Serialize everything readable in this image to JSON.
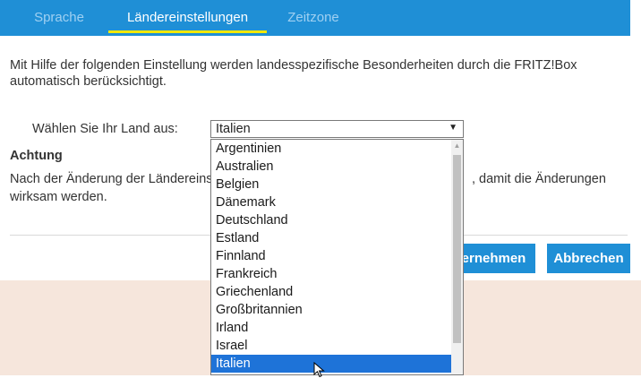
{
  "tabs": [
    {
      "label": "Sprache",
      "active": false
    },
    {
      "label": "Ländereinstellungen",
      "active": true
    },
    {
      "label": "Zeitzone",
      "active": false
    }
  ],
  "description": "Mit Hilfe der folgenden Einstellung werden landesspezifische Besonderheiten durch die FRITZ!Box automatisch berücksichtigt.",
  "country": {
    "label": "Wählen Sie Ihr Land aus:",
    "selected": "Italien",
    "options": [
      "Argentinien",
      "Australien",
      "Belgien",
      "Dänemark",
      "Deutschland",
      "Estland",
      "Finnland",
      "Frankreich",
      "Griechenland",
      "Großbritannien",
      "Irland",
      "Israel",
      "Italien"
    ]
  },
  "warning": {
    "title": "Achtung",
    "line1": "Nach der Änderung der Ländereinst",
    "line1_tail": ", damit die Änderungen",
    "line2": "wirksam werden."
  },
  "buttons": {
    "apply": "ernehmen",
    "cancel": "Abbrechen"
  },
  "colors": {
    "accent": "#1f8fd6",
    "tab_underline": "#f2e800",
    "footer_band": "#f6e6dc",
    "selection": "#1e73d8"
  }
}
